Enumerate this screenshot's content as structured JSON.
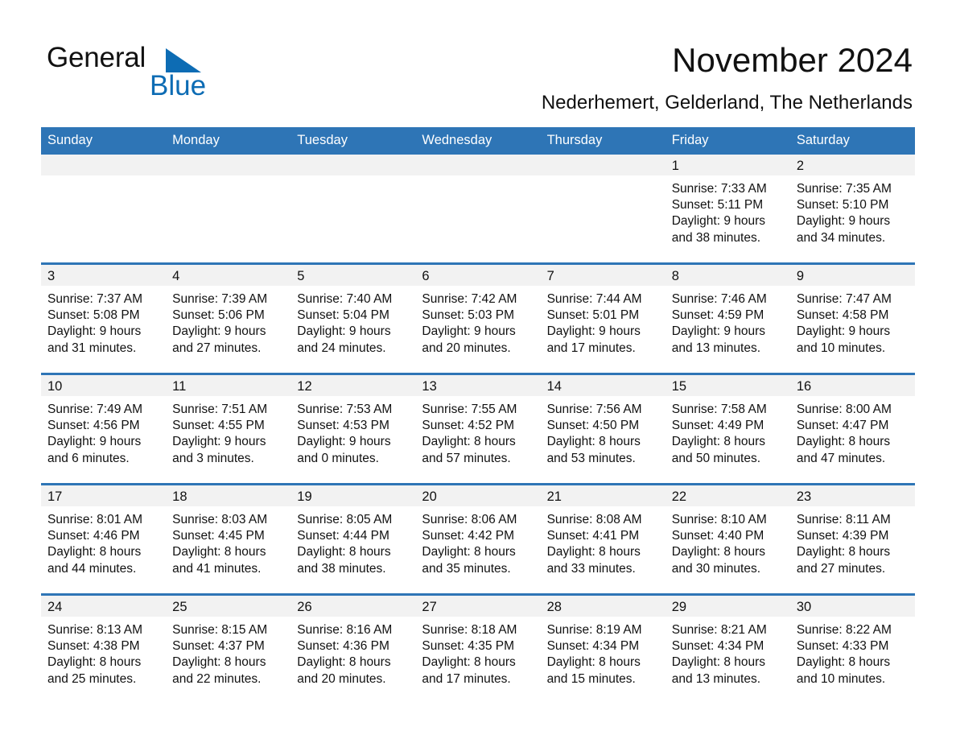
{
  "brand": {
    "name_part1": "General",
    "name_part2": "Blue",
    "triangle_color": "#0d6cb4"
  },
  "header": {
    "title": "November 2024",
    "subtitle": "Nederhemert, Gelderland, The Netherlands"
  },
  "theme": {
    "header_blue": "#2e75b6",
    "daynum_bg": "#f2f2f2",
    "text": "#111111"
  },
  "calendar": {
    "weekday_headers": [
      "Sunday",
      "Monday",
      "Tuesday",
      "Wednesday",
      "Thursday",
      "Friday",
      "Saturday"
    ],
    "weeks": [
      [
        {
          "day": "",
          "sunrise": "",
          "sunset": "",
          "daylight1": "",
          "daylight2": ""
        },
        {
          "day": "",
          "sunrise": "",
          "sunset": "",
          "daylight1": "",
          "daylight2": ""
        },
        {
          "day": "",
          "sunrise": "",
          "sunset": "",
          "daylight1": "",
          "daylight2": ""
        },
        {
          "day": "",
          "sunrise": "",
          "sunset": "",
          "daylight1": "",
          "daylight2": ""
        },
        {
          "day": "",
          "sunrise": "",
          "sunset": "",
          "daylight1": "",
          "daylight2": ""
        },
        {
          "day": "1",
          "sunrise": "Sunrise: 7:33 AM",
          "sunset": "Sunset: 5:11 PM",
          "daylight1": "Daylight: 9 hours",
          "daylight2": "and 38 minutes."
        },
        {
          "day": "2",
          "sunrise": "Sunrise: 7:35 AM",
          "sunset": "Sunset: 5:10 PM",
          "daylight1": "Daylight: 9 hours",
          "daylight2": "and 34 minutes."
        }
      ],
      [
        {
          "day": "3",
          "sunrise": "Sunrise: 7:37 AM",
          "sunset": "Sunset: 5:08 PM",
          "daylight1": "Daylight: 9 hours",
          "daylight2": "and 31 minutes."
        },
        {
          "day": "4",
          "sunrise": "Sunrise: 7:39 AM",
          "sunset": "Sunset: 5:06 PM",
          "daylight1": "Daylight: 9 hours",
          "daylight2": "and 27 minutes."
        },
        {
          "day": "5",
          "sunrise": "Sunrise: 7:40 AM",
          "sunset": "Sunset: 5:04 PM",
          "daylight1": "Daylight: 9 hours",
          "daylight2": "and 24 minutes."
        },
        {
          "day": "6",
          "sunrise": "Sunrise: 7:42 AM",
          "sunset": "Sunset: 5:03 PM",
          "daylight1": "Daylight: 9 hours",
          "daylight2": "and 20 minutes."
        },
        {
          "day": "7",
          "sunrise": "Sunrise: 7:44 AM",
          "sunset": "Sunset: 5:01 PM",
          "daylight1": "Daylight: 9 hours",
          "daylight2": "and 17 minutes."
        },
        {
          "day": "8",
          "sunrise": "Sunrise: 7:46 AM",
          "sunset": "Sunset: 4:59 PM",
          "daylight1": "Daylight: 9 hours",
          "daylight2": "and 13 minutes."
        },
        {
          "day": "9",
          "sunrise": "Sunrise: 7:47 AM",
          "sunset": "Sunset: 4:58 PM",
          "daylight1": "Daylight: 9 hours",
          "daylight2": "and 10 minutes."
        }
      ],
      [
        {
          "day": "10",
          "sunrise": "Sunrise: 7:49 AM",
          "sunset": "Sunset: 4:56 PM",
          "daylight1": "Daylight: 9 hours",
          "daylight2": "and 6 minutes."
        },
        {
          "day": "11",
          "sunrise": "Sunrise: 7:51 AM",
          "sunset": "Sunset: 4:55 PM",
          "daylight1": "Daylight: 9 hours",
          "daylight2": "and 3 minutes."
        },
        {
          "day": "12",
          "sunrise": "Sunrise: 7:53 AM",
          "sunset": "Sunset: 4:53 PM",
          "daylight1": "Daylight: 9 hours",
          "daylight2": "and 0 minutes."
        },
        {
          "day": "13",
          "sunrise": "Sunrise: 7:55 AM",
          "sunset": "Sunset: 4:52 PM",
          "daylight1": "Daylight: 8 hours",
          "daylight2": "and 57 minutes."
        },
        {
          "day": "14",
          "sunrise": "Sunrise: 7:56 AM",
          "sunset": "Sunset: 4:50 PM",
          "daylight1": "Daylight: 8 hours",
          "daylight2": "and 53 minutes."
        },
        {
          "day": "15",
          "sunrise": "Sunrise: 7:58 AM",
          "sunset": "Sunset: 4:49 PM",
          "daylight1": "Daylight: 8 hours",
          "daylight2": "and 50 minutes."
        },
        {
          "day": "16",
          "sunrise": "Sunrise: 8:00 AM",
          "sunset": "Sunset: 4:47 PM",
          "daylight1": "Daylight: 8 hours",
          "daylight2": "and 47 minutes."
        }
      ],
      [
        {
          "day": "17",
          "sunrise": "Sunrise: 8:01 AM",
          "sunset": "Sunset: 4:46 PM",
          "daylight1": "Daylight: 8 hours",
          "daylight2": "and 44 minutes."
        },
        {
          "day": "18",
          "sunrise": "Sunrise: 8:03 AM",
          "sunset": "Sunset: 4:45 PM",
          "daylight1": "Daylight: 8 hours",
          "daylight2": "and 41 minutes."
        },
        {
          "day": "19",
          "sunrise": "Sunrise: 8:05 AM",
          "sunset": "Sunset: 4:44 PM",
          "daylight1": "Daylight: 8 hours",
          "daylight2": "and 38 minutes."
        },
        {
          "day": "20",
          "sunrise": "Sunrise: 8:06 AM",
          "sunset": "Sunset: 4:42 PM",
          "daylight1": "Daylight: 8 hours",
          "daylight2": "and 35 minutes."
        },
        {
          "day": "21",
          "sunrise": "Sunrise: 8:08 AM",
          "sunset": "Sunset: 4:41 PM",
          "daylight1": "Daylight: 8 hours",
          "daylight2": "and 33 minutes."
        },
        {
          "day": "22",
          "sunrise": "Sunrise: 8:10 AM",
          "sunset": "Sunset: 4:40 PM",
          "daylight1": "Daylight: 8 hours",
          "daylight2": "and 30 minutes."
        },
        {
          "day": "23",
          "sunrise": "Sunrise: 8:11 AM",
          "sunset": "Sunset: 4:39 PM",
          "daylight1": "Daylight: 8 hours",
          "daylight2": "and 27 minutes."
        }
      ],
      [
        {
          "day": "24",
          "sunrise": "Sunrise: 8:13 AM",
          "sunset": "Sunset: 4:38 PM",
          "daylight1": "Daylight: 8 hours",
          "daylight2": "and 25 minutes."
        },
        {
          "day": "25",
          "sunrise": "Sunrise: 8:15 AM",
          "sunset": "Sunset: 4:37 PM",
          "daylight1": "Daylight: 8 hours",
          "daylight2": "and 22 minutes."
        },
        {
          "day": "26",
          "sunrise": "Sunrise: 8:16 AM",
          "sunset": "Sunset: 4:36 PM",
          "daylight1": "Daylight: 8 hours",
          "daylight2": "and 20 minutes."
        },
        {
          "day": "27",
          "sunrise": "Sunrise: 8:18 AM",
          "sunset": "Sunset: 4:35 PM",
          "daylight1": "Daylight: 8 hours",
          "daylight2": "and 17 minutes."
        },
        {
          "day": "28",
          "sunrise": "Sunrise: 8:19 AM",
          "sunset": "Sunset: 4:34 PM",
          "daylight1": "Daylight: 8 hours",
          "daylight2": "and 15 minutes."
        },
        {
          "day": "29",
          "sunrise": "Sunrise: 8:21 AM",
          "sunset": "Sunset: 4:34 PM",
          "daylight1": "Daylight: 8 hours",
          "daylight2": "and 13 minutes."
        },
        {
          "day": "30",
          "sunrise": "Sunrise: 8:22 AM",
          "sunset": "Sunset: 4:33 PM",
          "daylight1": "Daylight: 8 hours",
          "daylight2": "and 10 minutes."
        }
      ]
    ]
  }
}
